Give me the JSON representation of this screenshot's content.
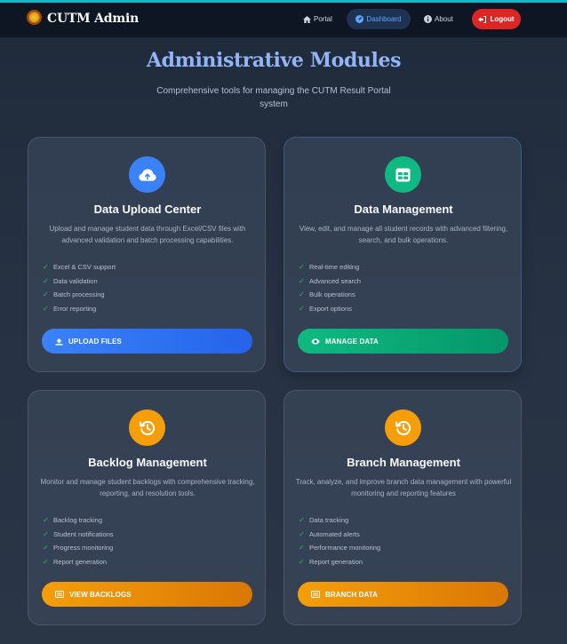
{
  "app": {
    "title": "CUTM Admin"
  },
  "nav": {
    "portal": "Portal",
    "dashboard": "Dashboard",
    "about": "About",
    "logout": "Logout"
  },
  "hero": {
    "title": "Administrative Modules",
    "subtitle": "Comprehensive tools for managing the CUTM Result Portal system"
  },
  "colors": {
    "accent_blue": "#3b82f6",
    "accent_green": "#10b981",
    "accent_orange": "#f59e0b",
    "logout_red": "#dc2626",
    "check_green": "#22c55e"
  },
  "cards": [
    {
      "title": "Data Upload Center",
      "description": "Upload and manage student data through Excel/CSV files with advanced validation and batch processing capabilities.",
      "icon": "cloud-upload-icon",
      "features": [
        "Excel & CSV support",
        "Data validation",
        "Batch processing",
        "Error reporting"
      ],
      "button": "UPLOAD FILES",
      "button_icon": "upload-icon"
    },
    {
      "title": "Data Management",
      "description": "View, edit, and manage all student records with advanced filtering, search, and bulk operations.",
      "icon": "table-icon",
      "features": [
        "Real-time editing",
        "Advanced search",
        "Bulk operations",
        "Export options"
      ],
      "button": "MANAGE DATA",
      "button_icon": "eye-icon"
    },
    {
      "title": "Backlog Management",
      "description": "Monitor and manage student backlogs with comprehensive tracking, reporting, and resolution tools.",
      "icon": "history-icon",
      "features": [
        "Backlog tracking",
        "Student notifications",
        "Progress monitoring",
        "Report generation"
      ],
      "button": "VIEW BACKLOGS",
      "button_icon": "list-icon"
    },
    {
      "title": "Branch Management",
      "description": "Track, analyze, and improve branch data management with powerful monitoring and reporting features",
      "icon": "history-icon",
      "features": [
        "Data tracking",
        "Automated alerts",
        "Performance monitoring",
        "Report generation"
      ],
      "button": "BRANCH DATA",
      "button_icon": "list-icon"
    }
  ]
}
